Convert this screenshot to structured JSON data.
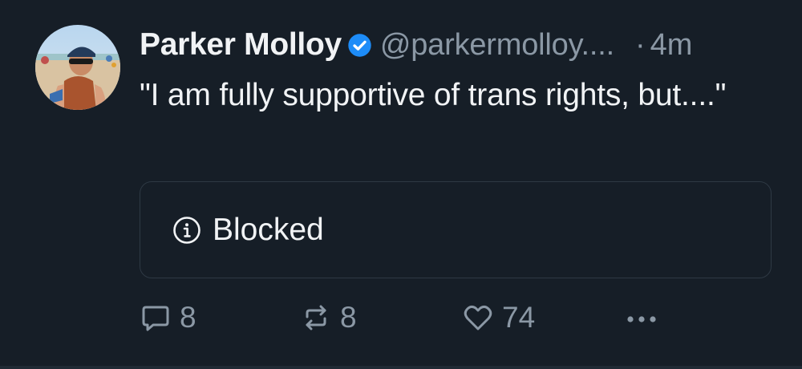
{
  "post": {
    "author": {
      "display_name": "Parker Molloy",
      "handle": "@parkermolloy....",
      "verified": true
    },
    "separator": "·",
    "timestamp": "4m",
    "text": "\"I am fully supportive of trans rights, but....\"",
    "embed": {
      "icon": "info-icon",
      "label": "Blocked"
    },
    "actions": {
      "reply_count": "8",
      "repost_count": "8",
      "like_count": "74",
      "more_icon": "more-icon"
    }
  },
  "colors": {
    "background": "#161e27",
    "primary_text": "#f1f3f5",
    "secondary_text": "#8b98a5",
    "verified_badge": "#1d8cf8",
    "border": "#2e3944"
  }
}
